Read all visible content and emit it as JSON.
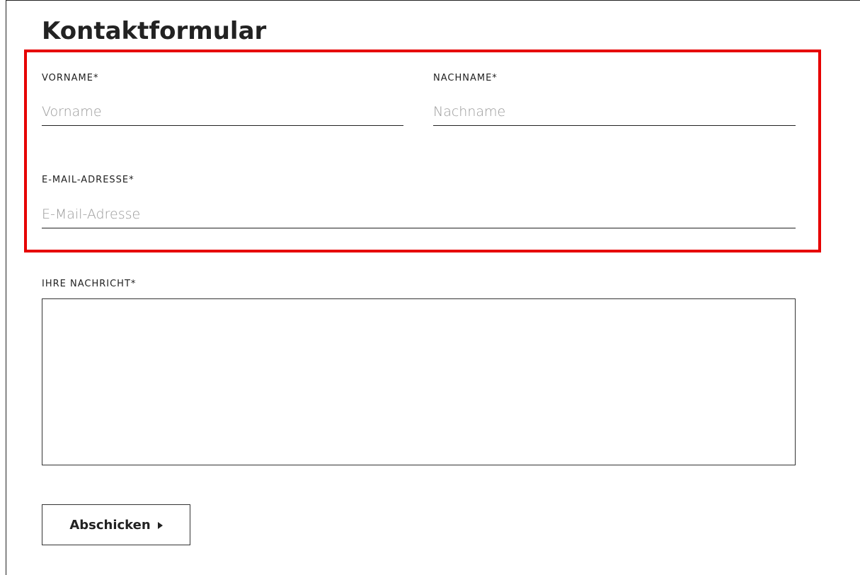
{
  "page": {
    "title": "Kontaktformular",
    "highlight_color": "#e60000"
  },
  "form": {
    "first_name": {
      "label": "VORNAME*",
      "placeholder": "Vorname",
      "value": ""
    },
    "last_name": {
      "label": "NACHNAME*",
      "placeholder": "Nachname",
      "value": ""
    },
    "email": {
      "label": "E-MAIL-ADRESSE*",
      "placeholder": "E-Mail-Adresse",
      "value": ""
    },
    "message": {
      "label": "IHRE NACHRICHT*",
      "value": ""
    },
    "submit": {
      "label": "Abschicken",
      "icon": "triangle-right-icon"
    }
  }
}
